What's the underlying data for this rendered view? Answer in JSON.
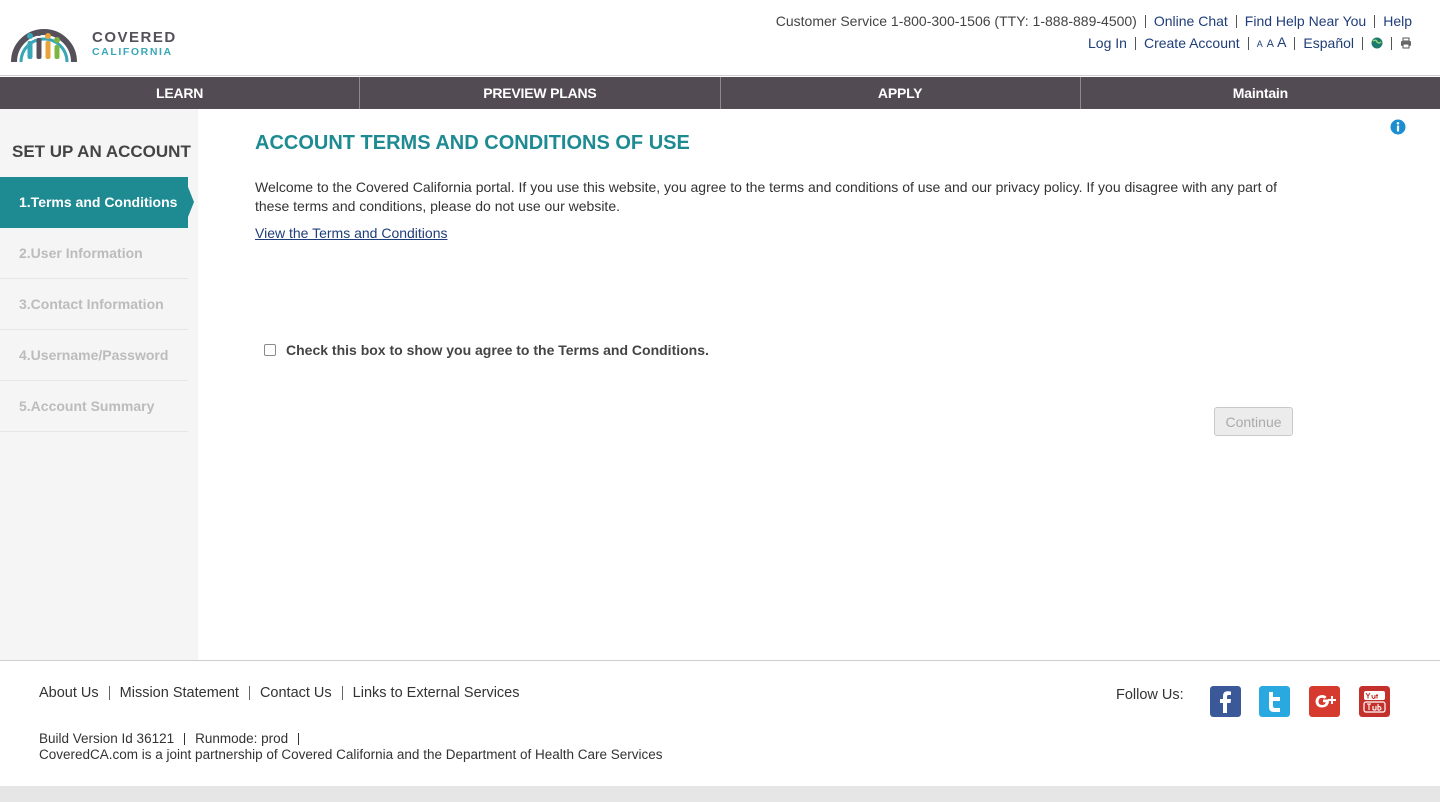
{
  "logo": {
    "line1": "COVERED",
    "line2": "CALIFORNIA"
  },
  "utility": {
    "customer_service": "Customer Service 1-800-300-1506 (TTY: 1-888-889-4500)",
    "online_chat": "Online Chat",
    "find_help": "Find Help Near You",
    "help": "Help",
    "log_in": "Log In",
    "create_account": "Create Account",
    "font_small": "A",
    "font_medium": "A",
    "font_large": "A",
    "espanol": "Español"
  },
  "nav": {
    "learn": "LEARN",
    "preview": "PREVIEW PLANS",
    "apply": "APPLY",
    "maintain": "Maintain"
  },
  "sidebar": {
    "title": "SET UP AN ACCOUNT",
    "steps": [
      {
        "label": "1.Terms and Conditions"
      },
      {
        "label": "2.User Information"
      },
      {
        "label": "3.Contact Information"
      },
      {
        "label": "4.Username/Password"
      },
      {
        "label": "5.Account Summary"
      }
    ]
  },
  "main": {
    "title": "ACCOUNT TERMS AND CONDITIONS OF USE",
    "welcome": "Welcome to the Covered California portal. If you use this website, you agree to the terms and conditions of use and our privacy policy. If you disagree with any part of these terms and conditions, please do not use our website.",
    "terms_link": "View the Terms and Conditions",
    "agree_label": "Check this box to show you agree to the Terms and Conditions.",
    "continue": "Continue"
  },
  "footer": {
    "about": "About Us",
    "mission": "Mission Statement",
    "contact": "Contact Us",
    "external": "Links to External Services",
    "follow": "Follow Us:",
    "build": "Build Version Id 36121",
    "runmode": "Runmode: prod",
    "partner": "CoveredCA.com is a joint partnership of Covered California and the Department of Health Care Services"
  },
  "colors": {
    "teal": "#1e8a92",
    "nav_bg": "#534b53",
    "link": "#1f3d7a",
    "facebook": "#3b5998",
    "twitter": "#2aa9e0",
    "google": "#d6392d",
    "youtube": "#c4302b"
  },
  "icons": [
    "logo-icon",
    "globe-icon",
    "print-icon",
    "info-icon",
    "facebook-icon",
    "twitter-icon",
    "google-plus-icon",
    "youtube-icon"
  ]
}
